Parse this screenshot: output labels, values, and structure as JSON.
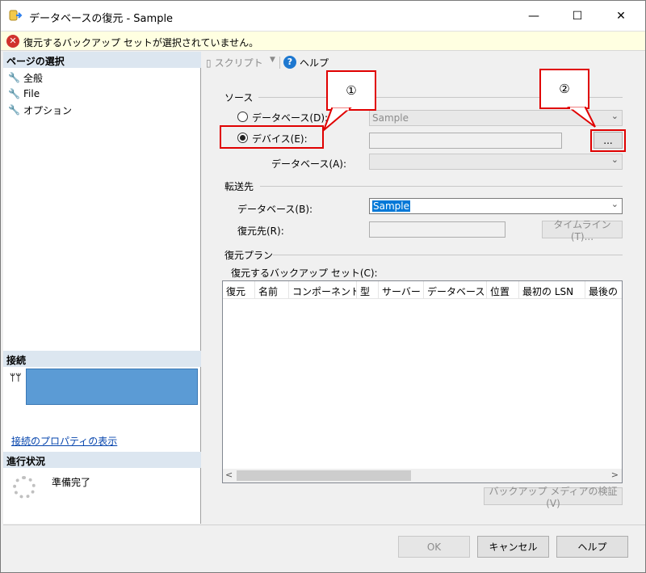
{
  "window": {
    "title": "データベースの復元 - Sample",
    "minimize": "—",
    "maximize": "☐",
    "close": "✕"
  },
  "error_bar": {
    "icon": "error-icon",
    "message": "復元するバックアップ セットが選択されていません。"
  },
  "left_pane": {
    "page_select_header": "ページの選択",
    "pages": [
      {
        "label": "全般",
        "icon": "wrench-icon"
      },
      {
        "label": "File",
        "icon": "wrench-icon"
      },
      {
        "label": "オプション",
        "icon": "wrench-icon"
      }
    ],
    "connection_header": "接続",
    "connection_icon": "connection-icon",
    "connection_props_link": "接続のプロパティの表示",
    "progress_header": "進行状況",
    "progress_status": "準備完了"
  },
  "toolbar": {
    "script_label": "スクリプト",
    "help_label": "ヘルプ"
  },
  "source": {
    "section_label": "ソース",
    "database_radio_label": "データベース(D):",
    "database_value": "Sample",
    "device_radio_label": "デバイス(E):",
    "device_value": "",
    "browse_button": "...",
    "device_database_label": "データベース(A):",
    "device_database_value": ""
  },
  "destination": {
    "section_label": "転送先",
    "database_label": "データベース(B):",
    "database_value": "Sample",
    "restore_to_label": "復元先(R):",
    "restore_to_value": "",
    "timeline_button": "タイムライン(T)..."
  },
  "restore_plan": {
    "section_label": "復元プラン",
    "backup_sets_label": "復元するバックアップ セット(C):",
    "columns": [
      "復元",
      "名前",
      "コンポーネント",
      "型",
      "サーバー",
      "データベース",
      "位置",
      "最初の LSN",
      "最後の"
    ],
    "scroll_left": "<",
    "scroll_right": ">",
    "verify_button": "バックアップ メディアの検証(V)"
  },
  "buttons": {
    "ok": "OK",
    "cancel": "キャンセル",
    "help": "ヘルプ"
  },
  "annotations": {
    "callout_1": "①",
    "callout_2": "②"
  },
  "colors": {
    "annotation_red": "#e00000",
    "selection_blue": "#0078d7",
    "connection_fill": "#5b9bd5",
    "error_bar_bg": "#ffffe1"
  }
}
